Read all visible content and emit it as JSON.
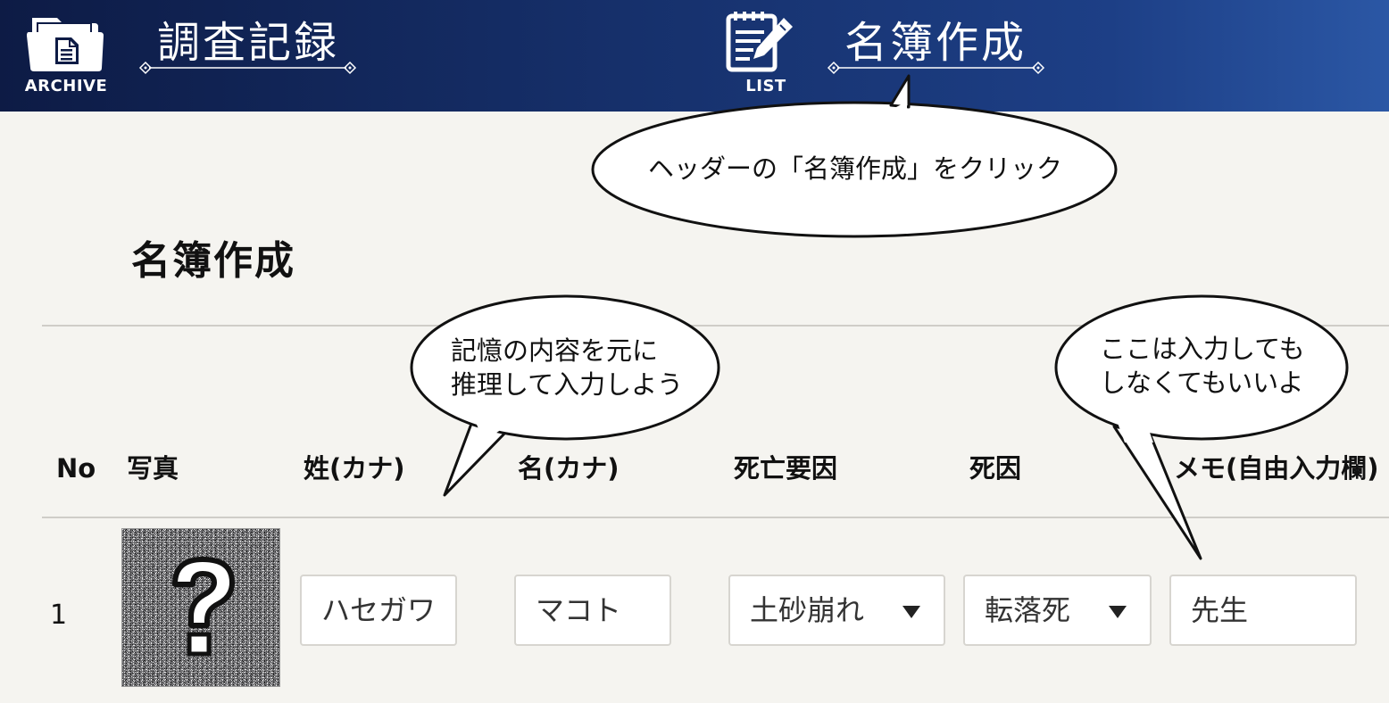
{
  "header": {
    "archive": {
      "caption": "ARCHIVE",
      "title": "調査記録"
    },
    "list": {
      "caption": "LIST",
      "title": "名簿作成"
    }
  },
  "page_title": "名簿作成",
  "table": {
    "columns": [
      "No",
      "写真",
      "姓(カナ)",
      "名(カナ)",
      "死亡要因",
      "死因",
      "メモ(自由入力欄)"
    ],
    "rows": [
      {
        "no": "1",
        "last_name": "ハセガワ",
        "first_name": "マコト",
        "death_factor": "土砂崩れ",
        "death_cause": "転落死",
        "memo": "先生"
      }
    ]
  },
  "bubbles": {
    "header_hint": "ヘッダーの「名簿作成」をクリック",
    "name_hint": [
      "記憶の内容を元に",
      "推理して入力しよう"
    ],
    "memo_hint": [
      "ここは入力しても",
      "しなくてもいいよ"
    ]
  },
  "colors": {
    "header_dark": "#0d1b45",
    "header_light": "#2b57a5",
    "background": "#f5f4f0"
  },
  "icons": {
    "archive": "folder-document-icon",
    "list": "notepad-pencil-icon",
    "photo": "question-mark-icon",
    "dropdown": "caret-down-icon"
  }
}
